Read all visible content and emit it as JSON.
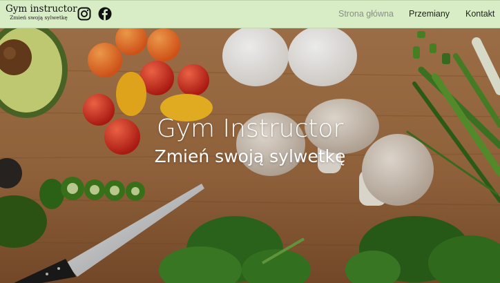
{
  "header": {
    "brand_title": "Gym instructor",
    "brand_subtitle": "Zmień swoją sylwetkę",
    "social": [
      "instagram-icon",
      "facebook-icon"
    ],
    "nav": {
      "home": "Strona główna",
      "transformations": "Przemiany",
      "contact": "Kontakt"
    },
    "background_color": "#d8ecc6"
  },
  "hero": {
    "title": "Gym Instructor",
    "subtitle": "Zmień swoją sylwetkę"
  }
}
